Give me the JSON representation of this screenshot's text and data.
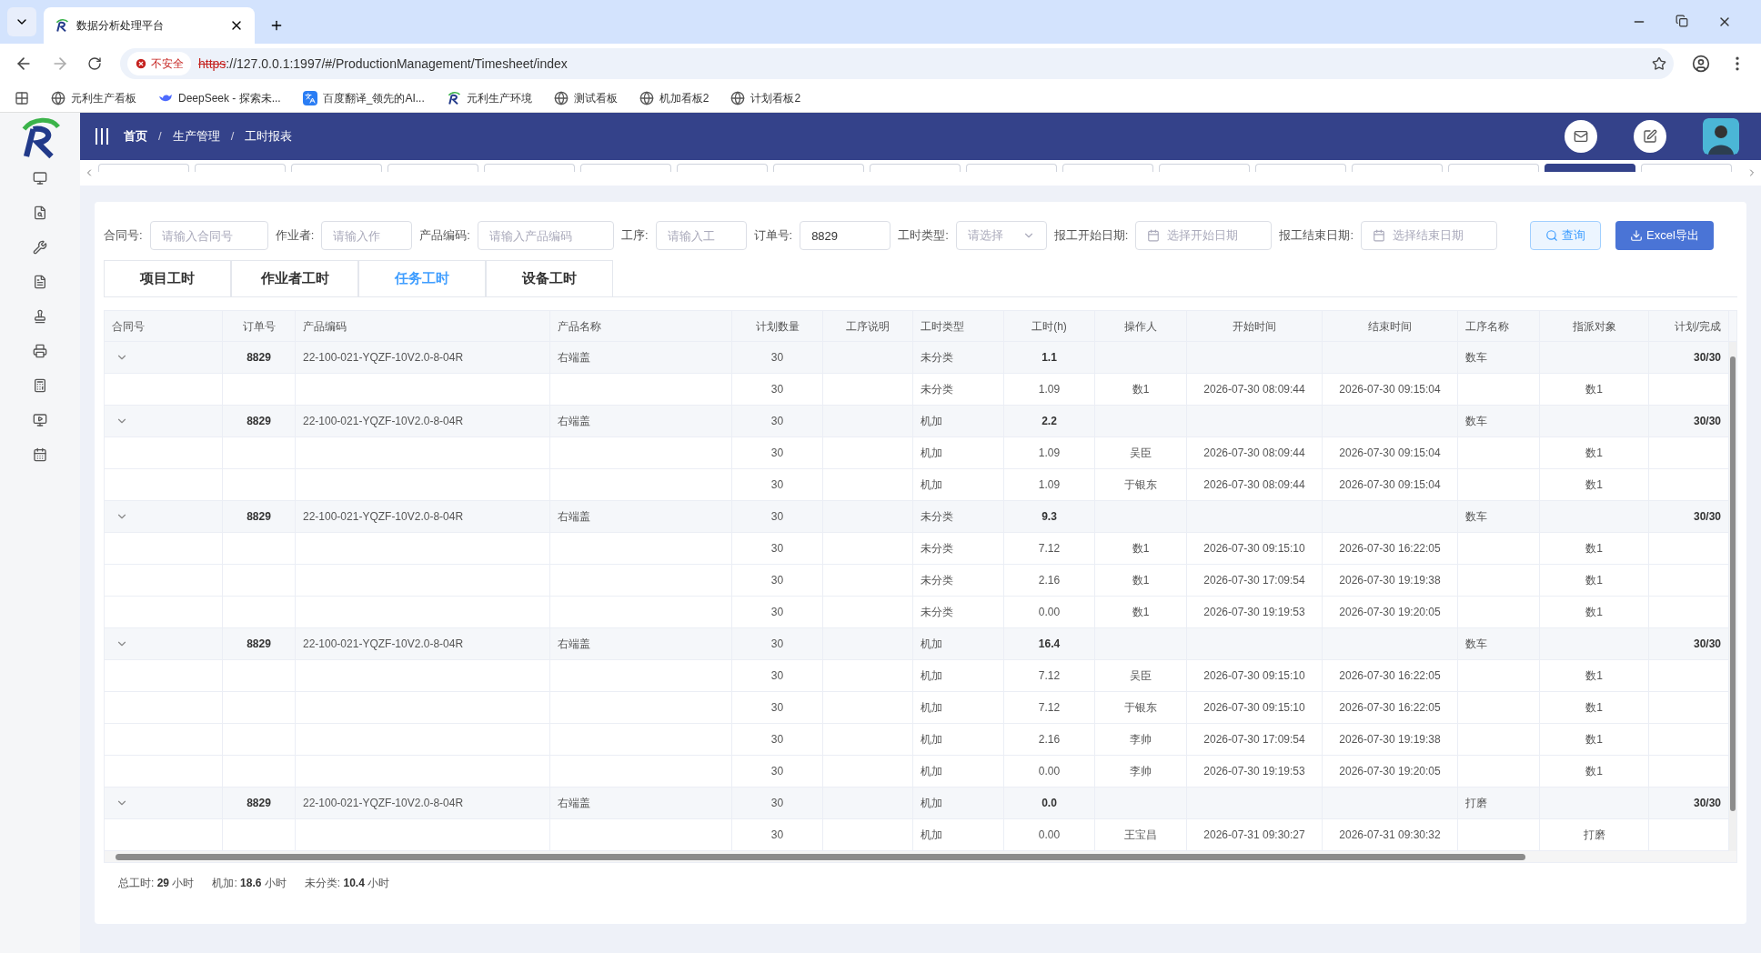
{
  "browser": {
    "tab_title": "数据分析处理平台",
    "insecure_label": "不安全",
    "url_scheme": "https",
    "url_rest": "://127.0.0.1:1997/#/ProductionManagement/Timesheet/index",
    "bookmarks": [
      {
        "kind": "globe",
        "label": "元利生产看板"
      },
      {
        "kind": "whale",
        "label": "DeepSeek - 探索未..."
      },
      {
        "kind": "translate",
        "label": "百度翻译_领先的AI..."
      },
      {
        "kind": "logo",
        "label": "元利生产环境"
      },
      {
        "kind": "globe",
        "label": "测试看板"
      },
      {
        "kind": "globe",
        "label": "机加看板2"
      },
      {
        "kind": "globe",
        "label": "计划看板2"
      }
    ]
  },
  "header": {
    "breadcrumb": [
      "首页",
      "生产管理",
      "工时报表"
    ],
    "breadcrumb_separator": "/"
  },
  "tag_bar": [
    {
      "selected": false
    },
    {
      "selected": false
    },
    {
      "selected": false
    },
    {
      "selected": false
    },
    {
      "selected": false
    },
    {
      "selected": false
    },
    {
      "selected": false
    },
    {
      "selected": false
    },
    {
      "selected": false
    },
    {
      "selected": false
    },
    {
      "selected": false
    },
    {
      "selected": false
    },
    {
      "selected": false
    },
    {
      "selected": false
    },
    {
      "selected": false
    },
    {
      "selected": true
    },
    {
      "selected": false
    }
  ],
  "filters": [
    {
      "kind": "input",
      "label": "合同号:",
      "placeholder": "请输入合同号"
    },
    {
      "kind": "input",
      "label": "作业者:",
      "placeholder": "请输入作"
    },
    {
      "kind": "input",
      "label": "产品编码:",
      "placeholder": "请输入产品编码"
    },
    {
      "kind": "input",
      "label": "工序:",
      "placeholder": "请输入工"
    },
    {
      "kind": "input",
      "label": "订单号:",
      "value": "8829"
    },
    {
      "kind": "select",
      "label": "工时类型:",
      "placeholder": "请选择"
    },
    {
      "kind": "date",
      "label": "报工开始日期:",
      "placeholder": "选择开始日期"
    },
    {
      "kind": "date",
      "label": "报工结束日期:",
      "placeholder": "选择结束日期"
    }
  ],
  "buttons": [
    {
      "kind": "search",
      "label": "查询"
    },
    {
      "kind": "export",
      "label": "Excel导出"
    }
  ],
  "tabs": [
    {
      "label": "项目工时",
      "selected": false
    },
    {
      "label": "作业者工时",
      "selected": false
    },
    {
      "label": "任务工时",
      "selected": true
    },
    {
      "label": "设备工时",
      "selected": false
    }
  ],
  "table": {
    "columns": [
      "合同号",
      "订单号",
      "产品编码",
      "产品名称",
      "计划数量",
      "工序说明",
      "工时类型",
      "工时(h)",
      "操作人",
      "开始时间",
      "结束时间",
      "工序名称",
      "指派对象",
      "计划/完成"
    ],
    "groups": [
      {
        "expanded": true,
        "cells": {
          "order": "8829",
          "code": "22-100-021-YQZF-10V2.0-8-04R",
          "product": "右端盖",
          "qty": "30",
          "type": "未分类",
          "hours": "1.1",
          "process": "数车",
          "plan": "30/30"
        },
        "children": [
          {
            "qty": "30",
            "type": "未分类",
            "hours": "1.09",
            "operator": "数1",
            "start": "2026-07-30 08:09:44",
            "end": "2026-07-30 09:15:04",
            "assignee": "数1"
          }
        ]
      },
      {
        "expanded": true,
        "cells": {
          "order": "8829",
          "code": "22-100-021-YQZF-10V2.0-8-04R",
          "product": "右端盖",
          "qty": "30",
          "type": "机加",
          "hours": "2.2",
          "process": "数车",
          "plan": "30/30"
        },
        "children": [
          {
            "qty": "30",
            "type": "机加",
            "hours": "1.09",
            "operator": "吴臣",
            "start": "2026-07-30 08:09:44",
            "end": "2026-07-30 09:15:04",
            "assignee": "数1"
          },
          {
            "qty": "30",
            "type": "机加",
            "hours": "1.09",
            "operator": "于银东",
            "start": "2026-07-30 08:09:44",
            "end": "2026-07-30 09:15:04",
            "assignee": "数1"
          }
        ]
      },
      {
        "expanded": true,
        "cells": {
          "order": "8829",
          "code": "22-100-021-YQZF-10V2.0-8-04R",
          "product": "右端盖",
          "qty": "30",
          "type": "未分类",
          "hours": "9.3",
          "process": "数车",
          "plan": "30/30"
        },
        "children": [
          {
            "qty": "30",
            "type": "未分类",
            "hours": "7.12",
            "operator": "数1",
            "start": "2026-07-30 09:15:10",
            "end": "2026-07-30 16:22:05",
            "assignee": "数1"
          },
          {
            "qty": "30",
            "type": "未分类",
            "hours": "2.16",
            "operator": "数1",
            "start": "2026-07-30 17:09:54",
            "end": "2026-07-30 19:19:38",
            "assignee": "数1"
          },
          {
            "qty": "30",
            "type": "未分类",
            "hours": "0.00",
            "operator": "数1",
            "start": "2026-07-30 19:19:53",
            "end": "2026-07-30 19:20:05",
            "assignee": "数1"
          }
        ]
      },
      {
        "expanded": true,
        "cells": {
          "order": "8829",
          "code": "22-100-021-YQZF-10V2.0-8-04R",
          "product": "右端盖",
          "qty": "30",
          "type": "机加",
          "hours": "16.4",
          "process": "数车",
          "plan": "30/30"
        },
        "children": [
          {
            "qty": "30",
            "type": "机加",
            "hours": "7.12",
            "operator": "吴臣",
            "start": "2026-07-30 09:15:10",
            "end": "2026-07-30 16:22:05",
            "assignee": "数1"
          },
          {
            "qty": "30",
            "type": "机加",
            "hours": "7.12",
            "operator": "于银东",
            "start": "2026-07-30 09:15:10",
            "end": "2026-07-30 16:22:05",
            "assignee": "数1"
          },
          {
            "qty": "30",
            "type": "机加",
            "hours": "2.16",
            "operator": "李帅",
            "start": "2026-07-30 17:09:54",
            "end": "2026-07-30 19:19:38",
            "assignee": "数1"
          },
          {
            "qty": "30",
            "type": "机加",
            "hours": "0.00",
            "operator": "李帅",
            "start": "2026-07-30 19:19:53",
            "end": "2026-07-30 19:20:05",
            "assignee": "数1"
          }
        ]
      },
      {
        "expanded": true,
        "cells": {
          "order": "8829",
          "code": "22-100-021-YQZF-10V2.0-8-04R",
          "product": "右端盖",
          "qty": "30",
          "type": "机加",
          "hours": "0.0",
          "process": "打磨",
          "plan": "30/30"
        },
        "children": [
          {
            "qty": "30",
            "type": "机加",
            "hours": "0.00",
            "operator": "王宝昌",
            "start": "2026-07-31 09:30:27",
            "end": "2026-07-31 09:30:32",
            "assignee": "打磨"
          }
        ]
      }
    ]
  },
  "summary": [
    {
      "label": "总工时:",
      "value": "29",
      "unit": "小时"
    },
    {
      "label": "机加:",
      "value": "18.6",
      "unit": "小时"
    },
    {
      "label": "未分类:",
      "value": "10.4",
      "unit": "小时"
    }
  ]
}
